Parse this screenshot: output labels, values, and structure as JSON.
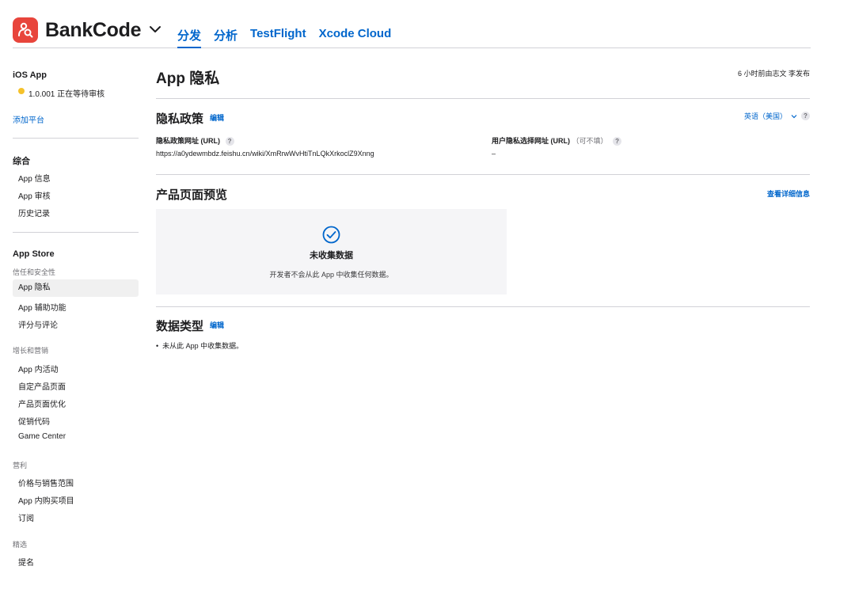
{
  "header": {
    "app_name": "BankCode",
    "tabs": [
      {
        "label": "分发",
        "active": true
      },
      {
        "label": "分析",
        "active": false
      },
      {
        "label": "TestFlight",
        "active": false
      },
      {
        "label": "Xcode Cloud",
        "active": false
      }
    ]
  },
  "sidebar": {
    "platform": "iOS App",
    "version_status": "1.0.001 正在等待审核",
    "status_color": "#f5c22b",
    "add_platform": "添加平台",
    "general_heading": "综合",
    "general_items": [
      "App 信息",
      "App 审核",
      "历史记录"
    ],
    "store_heading": "App Store",
    "trust_group": "信任和安全性",
    "trust_items": [
      "App 隐私",
      "App 辅助功能",
      "评分与评论"
    ],
    "growth_group": "增长和营销",
    "growth_items": [
      "App 内活动",
      "自定产品页面",
      "产品页面优化",
      "促销代码",
      "Game Center"
    ],
    "monetize_group": "营利",
    "monetize_items": [
      "价格与销售范围",
      "App 内购买项目",
      "订阅"
    ],
    "featured_group": "精选",
    "featured_items": [
      "提名"
    ]
  },
  "main": {
    "title": "App 隐私",
    "published_note": "6 小时前由志文 李发布",
    "policy": {
      "title": "隐私政策",
      "edit": "编辑",
      "language": "英语（美国）",
      "url_label": "隐私政策网址 (URL)",
      "url_value": "https://a0ydewmbdz.feishu.cn/wiki/XmRrwWvHtiTnLQkXrkoclZ9Xnng",
      "choice_label": "用户隐私选择网址 (URL)",
      "choice_optional": "（可不填）",
      "choice_value": "–"
    },
    "preview": {
      "title": "产品页面预览",
      "details_link": "查看详细信息",
      "heading": "未收集数据",
      "body": "开发者不会从此 App 中收集任何数据。"
    },
    "data_types": {
      "title": "数据类型",
      "edit": "编辑",
      "bullet": "未从此 App 中收集数据。"
    }
  },
  "colors": {
    "accent": "#0066cc",
    "brand": "#e8453c"
  }
}
